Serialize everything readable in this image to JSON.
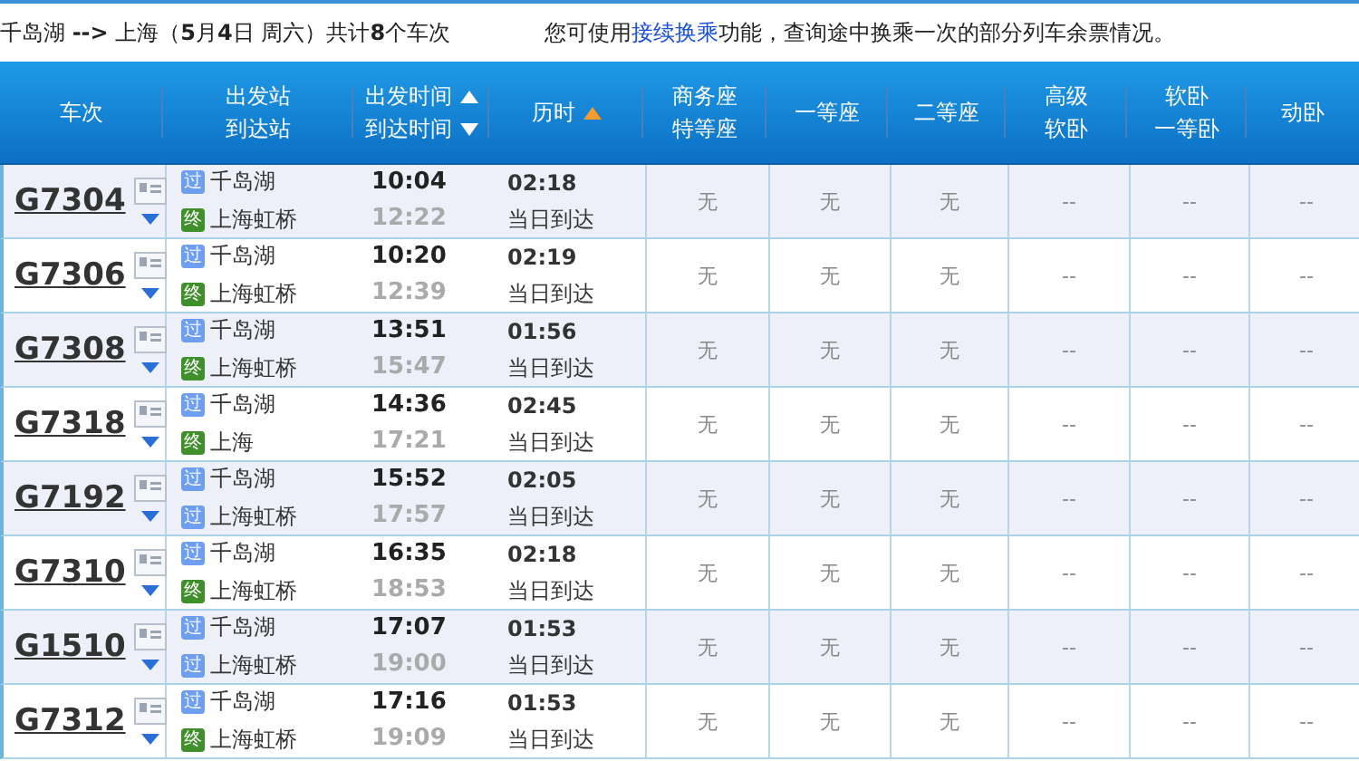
{
  "summary": "千岛湖 **-->** 上海（**5**月**4**日  周六）共计**8**个车次",
  "notice": {
    "before": "您可使用",
    "link": "接续换乘",
    "after": "功能，查询途中换乘一次的部分列车余票情况。"
  },
  "columns": [
    {
      "lines": [
        "车次"
      ]
    },
    {
      "lines": [
        "出发站",
        "到达站"
      ]
    },
    {
      "lines": [
        "出发时间",
        "到达时间"
      ],
      "sorts": [
        {
          "ascending": true,
          "active": false
        },
        {
          "ascending": false,
          "active": false
        }
      ]
    },
    {
      "lines": [
        "历时"
      ],
      "sorts": [
        {
          "ascending": true,
          "active": true
        }
      ]
    },
    {
      "lines": [
        "商务座",
        "特等座"
      ]
    },
    {
      "lines": [
        "一等座"
      ]
    },
    {
      "lines": [
        "二等座"
      ]
    },
    {
      "lines": [
        "高级",
        "软卧"
      ]
    },
    {
      "lines": [
        "软卧",
        "一等卧"
      ]
    },
    {
      "lines": [
        "动卧"
      ]
    }
  ],
  "rows": [
    {
      "train": "G7304",
      "from": {
        "kind": "pass",
        "badge": "过",
        "name": "千岛湖"
      },
      "to": {
        "kind": "end",
        "badge": "终",
        "name": "上海虹桥"
      },
      "depart": "10:04",
      "arrive": "12:22",
      "duration": "02:18",
      "arrival_day": "当日到达",
      "seats": [
        "无",
        "无",
        "无",
        "--",
        "--",
        "--"
      ]
    },
    {
      "train": "G7306",
      "from": {
        "kind": "pass",
        "badge": "过",
        "name": "千岛湖"
      },
      "to": {
        "kind": "end",
        "badge": "终",
        "name": "上海虹桥"
      },
      "depart": "10:20",
      "arrive": "12:39",
      "duration": "02:19",
      "arrival_day": "当日到达",
      "seats": [
        "无",
        "无",
        "无",
        "--",
        "--",
        "--"
      ]
    },
    {
      "train": "G7308",
      "from": {
        "kind": "pass",
        "badge": "过",
        "name": "千岛湖"
      },
      "to": {
        "kind": "end",
        "badge": "终",
        "name": "上海虹桥"
      },
      "depart": "13:51",
      "arrive": "15:47",
      "duration": "01:56",
      "arrival_day": "当日到达",
      "seats": [
        "无",
        "无",
        "无",
        "--",
        "--",
        "--"
      ]
    },
    {
      "train": "G7318",
      "from": {
        "kind": "pass",
        "badge": "过",
        "name": "千岛湖"
      },
      "to": {
        "kind": "end",
        "badge": "终",
        "name": "上海"
      },
      "depart": "14:36",
      "arrive": "17:21",
      "duration": "02:45",
      "arrival_day": "当日到达",
      "seats": [
        "无",
        "无",
        "无",
        "--",
        "--",
        "--"
      ]
    },
    {
      "train": "G7192",
      "from": {
        "kind": "pass",
        "badge": "过",
        "name": "千岛湖"
      },
      "to": {
        "kind": "pass",
        "badge": "过",
        "name": "上海虹桥"
      },
      "depart": "15:52",
      "arrive": "17:57",
      "duration": "02:05",
      "arrival_day": "当日到达",
      "seats": [
        "无",
        "无",
        "无",
        "--",
        "--",
        "--"
      ]
    },
    {
      "train": "G7310",
      "from": {
        "kind": "pass",
        "badge": "过",
        "name": "千岛湖"
      },
      "to": {
        "kind": "end",
        "badge": "终",
        "name": "上海虹桥"
      },
      "depart": "16:35",
      "arrive": "18:53",
      "duration": "02:18",
      "arrival_day": "当日到达",
      "seats": [
        "无",
        "无",
        "无",
        "--",
        "--",
        "--"
      ]
    },
    {
      "train": "G1510",
      "from": {
        "kind": "pass",
        "badge": "过",
        "name": "千岛湖"
      },
      "to": {
        "kind": "pass",
        "badge": "过",
        "name": "上海虹桥"
      },
      "depart": "17:07",
      "arrive": "19:00",
      "duration": "01:53",
      "arrival_day": "当日到达",
      "seats": [
        "无",
        "无",
        "无",
        "--",
        "--",
        "--"
      ]
    },
    {
      "train": "G7312",
      "from": {
        "kind": "pass",
        "badge": "过",
        "name": "千岛湖"
      },
      "to": {
        "kind": "end",
        "badge": "终",
        "name": "上海虹桥"
      },
      "depart": "17:16",
      "arrive": "19:09",
      "duration": "01:53",
      "arrival_day": "当日到达",
      "seats": [
        "无",
        "无",
        "无",
        "--",
        "--",
        "--"
      ]
    }
  ]
}
